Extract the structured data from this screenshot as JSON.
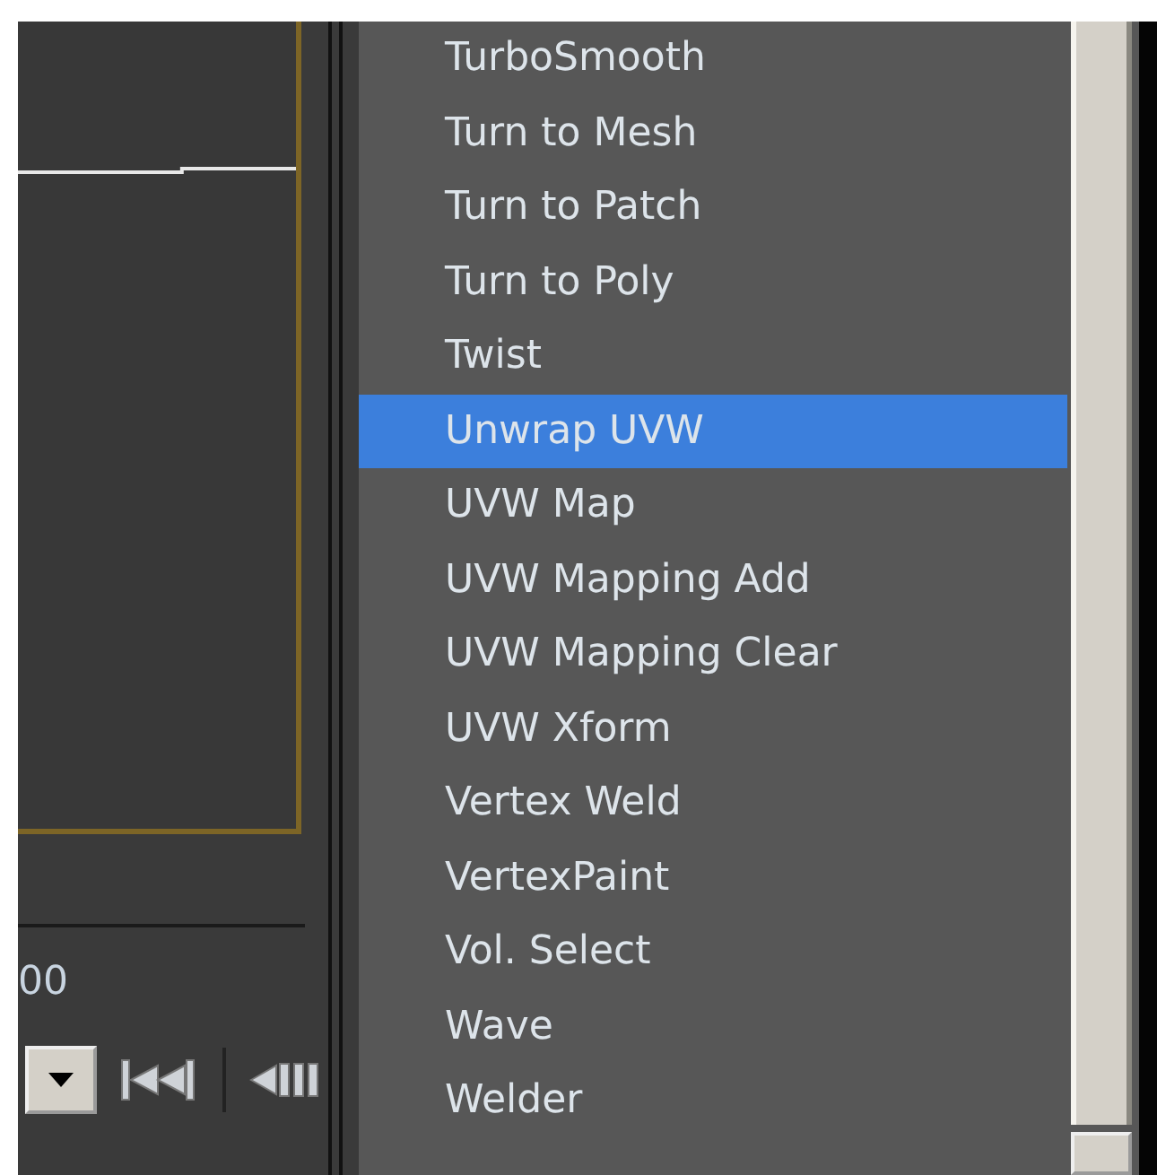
{
  "modifier_list": {
    "items": [
      {
        "label": "TurboSmooth",
        "selected": false
      },
      {
        "label": "Turn to Mesh",
        "selected": false
      },
      {
        "label": "Turn to Patch",
        "selected": false
      },
      {
        "label": "Turn to Poly",
        "selected": false
      },
      {
        "label": "Twist",
        "selected": false
      },
      {
        "label": "Unwrap UVW",
        "selected": true
      },
      {
        "label": "UVW Map",
        "selected": false
      },
      {
        "label": "UVW Mapping Add",
        "selected": false
      },
      {
        "label": "UVW Mapping Clear",
        "selected": false
      },
      {
        "label": "UVW Xform",
        "selected": false
      },
      {
        "label": "Vertex Weld",
        "selected": false
      },
      {
        "label": "VertexPaint",
        "selected": false
      },
      {
        "label": "Vol. Select",
        "selected": false
      },
      {
        "label": "Wave",
        "selected": false
      },
      {
        "label": "Welder",
        "selected": false
      }
    ]
  },
  "timeline": {
    "frame_label": "00"
  }
}
